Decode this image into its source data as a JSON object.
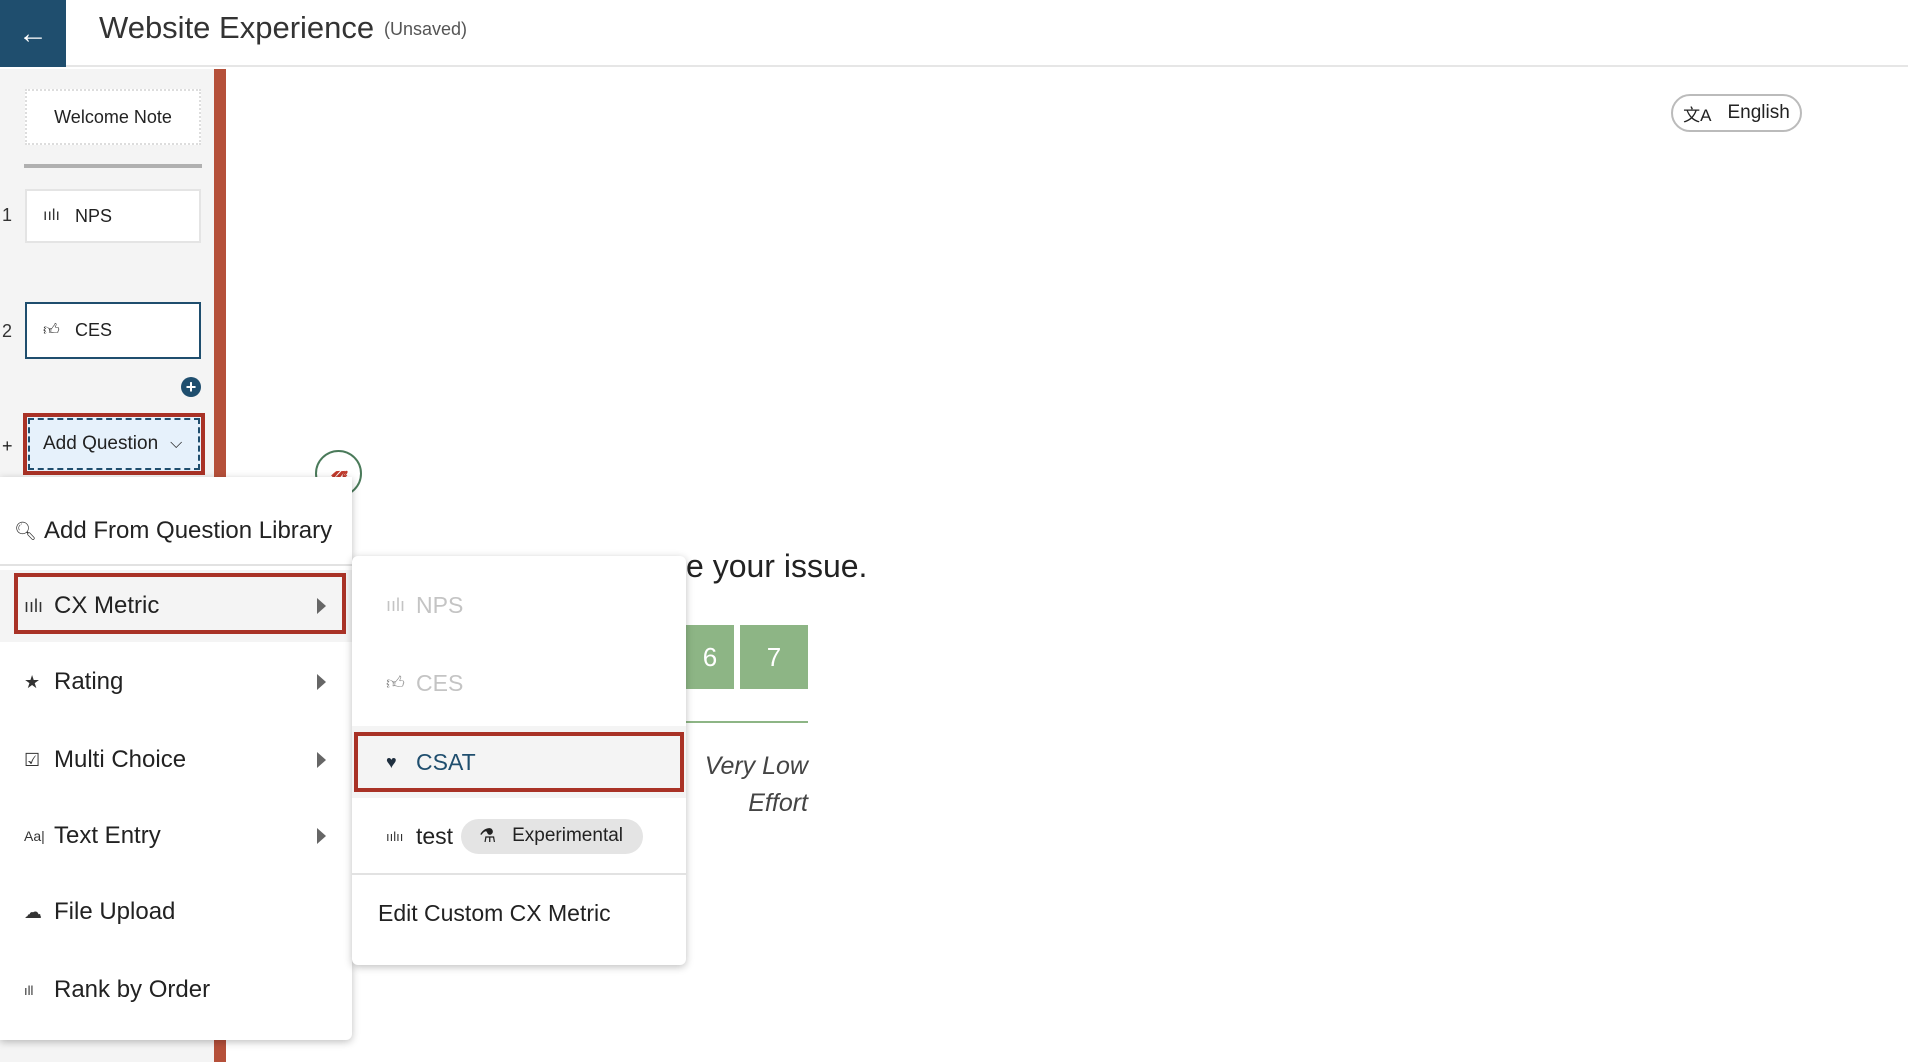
{
  "header": {
    "title": "Website Experience",
    "status": "(Unsaved)",
    "back_icon": "arrow-left-icon"
  },
  "sidebar": {
    "welcome": "Welcome Note",
    "questions": [
      {
        "number": "1",
        "label": "NPS",
        "icon": "nps-gauge-icon"
      },
      {
        "number": "2",
        "label": "CES",
        "icon": "thumbs-up-icon"
      }
    ],
    "add_question": "Add Question",
    "add_plus": "+"
  },
  "menu": {
    "library": "Add From Question Library",
    "items": [
      {
        "label": "CX Metric",
        "icon": "nps-gauge-icon"
      },
      {
        "label": "Rating",
        "icon": "star-icon"
      },
      {
        "label": "Multi Choice",
        "icon": "checkbox-icon"
      },
      {
        "label": "Text Entry",
        "icon": "text-entry-icon"
      },
      {
        "label": "File Upload",
        "icon": "cloud-upload-icon"
      },
      {
        "label": "Rank by Order",
        "icon": "bars-icon"
      }
    ]
  },
  "submenu": {
    "items": [
      {
        "label": "NPS",
        "disabled": true
      },
      {
        "label": "CES",
        "disabled": true
      },
      {
        "label": "CSAT",
        "selected": true
      },
      {
        "label": "test",
        "badge": "Experimental"
      }
    ],
    "edit": "Edit Custom CX Metric"
  },
  "preview": {
    "question_fragment": "e your issue.",
    "scale": [
      "6",
      "7"
    ],
    "scale_label": "Very Low Effort"
  },
  "language": {
    "label": "English"
  },
  "colors": {
    "primary": "#1f4e6e",
    "highlight": "#a93226",
    "scale_green": "#8db585",
    "sidebar_bar": "#b5503a"
  }
}
